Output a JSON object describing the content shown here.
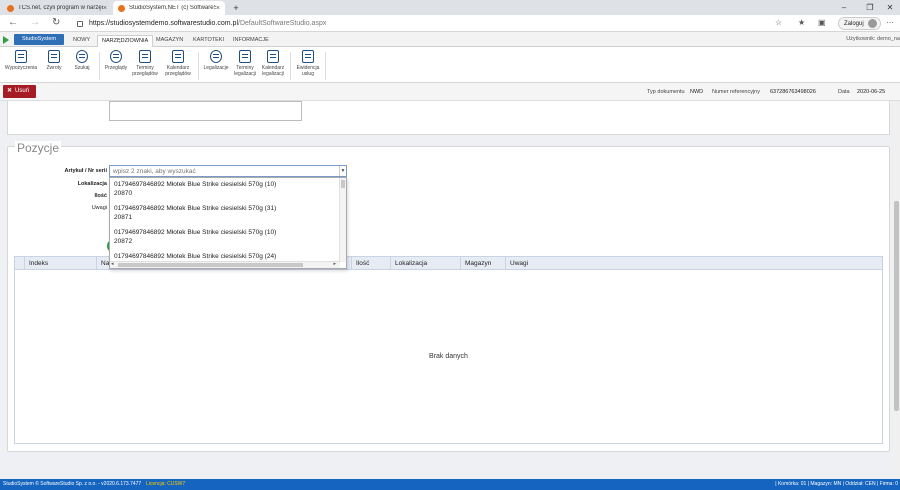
{
  "browser": {
    "tabs": [
      {
        "title": "TCS.net, czyli program w narzędzi"
      },
      {
        "title": "StudioSystem.NET (c) SoftwareS"
      }
    ],
    "url_host": "https://studiosystemdemo.softwarestudio.com.pl",
    "url_path": "/DefaultSoftwareStudio.aspx",
    "login_label": "Zaloguj"
  },
  "app": {
    "brand": "StudioSystem",
    "menu_tabs": [
      "NOWY",
      "NARZĘDZIOWNIA",
      "MAGAZYN",
      "KARTOTEKI",
      "INFORMACJE"
    ],
    "active_tab": "NARZĘDZIOWNIA",
    "user_label": "Użytkownik: demo_na",
    "ribbon": [
      {
        "label": "Wypożyczenia",
        "icon": "document-icon"
      },
      {
        "label": "Zwroty",
        "icon": "document-icon"
      },
      {
        "label": "Szukaj",
        "icon": "search-person-icon"
      },
      {
        "label": "Przeglądy",
        "icon": "gear-icon"
      },
      {
        "label": "Terminy przeglądów",
        "icon": "calendar-icon"
      },
      {
        "label": "Kalendarz przeglądów",
        "icon": "calendar-icon"
      },
      {
        "label": "Legalizacje",
        "icon": "gear-icon"
      },
      {
        "label": "Terminy legalizacji",
        "icon": "calendar-icon"
      },
      {
        "label": "Kalendarz legalizacji",
        "icon": "calendar-icon"
      },
      {
        "label": "Ewidencja usług",
        "icon": "document-icon"
      }
    ]
  },
  "toolbar": {
    "delete_label": "Usuń",
    "doc_type_label": "Typ dokumentu",
    "doc_type_value": "NWD",
    "ref_number_label": "Numer referencyjny",
    "ref_number_value": "637286763498026",
    "date_label": "Data",
    "date_value": "2020-06-25"
  },
  "form": {
    "section_title": "Pozycje",
    "article_label": "Artykuł / Nr serii",
    "article_placeholder": "wpisz 2 znaki, aby wyszukać",
    "location_label": "Lokalizacja",
    "quantity_label": "Ilość",
    "notes_label": "Uwagi",
    "dropdown_items": [
      {
        "line1": "01794697846892 Młotek Blue Strike ciesielski 570g (10)",
        "line2": "20870"
      },
      {
        "line1": "01794697846892 Młotek Blue Strike ciesielski 570g (31)",
        "line2": "20871"
      },
      {
        "line1": "01794697846892 Młotek Blue Strike ciesielski 570g (10)",
        "line2": "20872"
      },
      {
        "line1": "01794697846892 Młotek Blue Strike ciesielski 570g (24)",
        "line2": ""
      }
    ]
  },
  "grid": {
    "columns": [
      "Indeks",
      "Naz",
      "Ilość",
      "Lokalizacja",
      "Magazyn",
      "Uwagi"
    ],
    "empty_text": "Brak danych"
  },
  "statusbar": {
    "left": "StudioSystem © SoftwareStudio Sp. z o.o. - v2020.6.173.7477",
    "license": "Licencja: CUSW7",
    "right": "| Komórka: 01 | Magazyn: MN | Oddział: CEN | Firma: 0"
  }
}
